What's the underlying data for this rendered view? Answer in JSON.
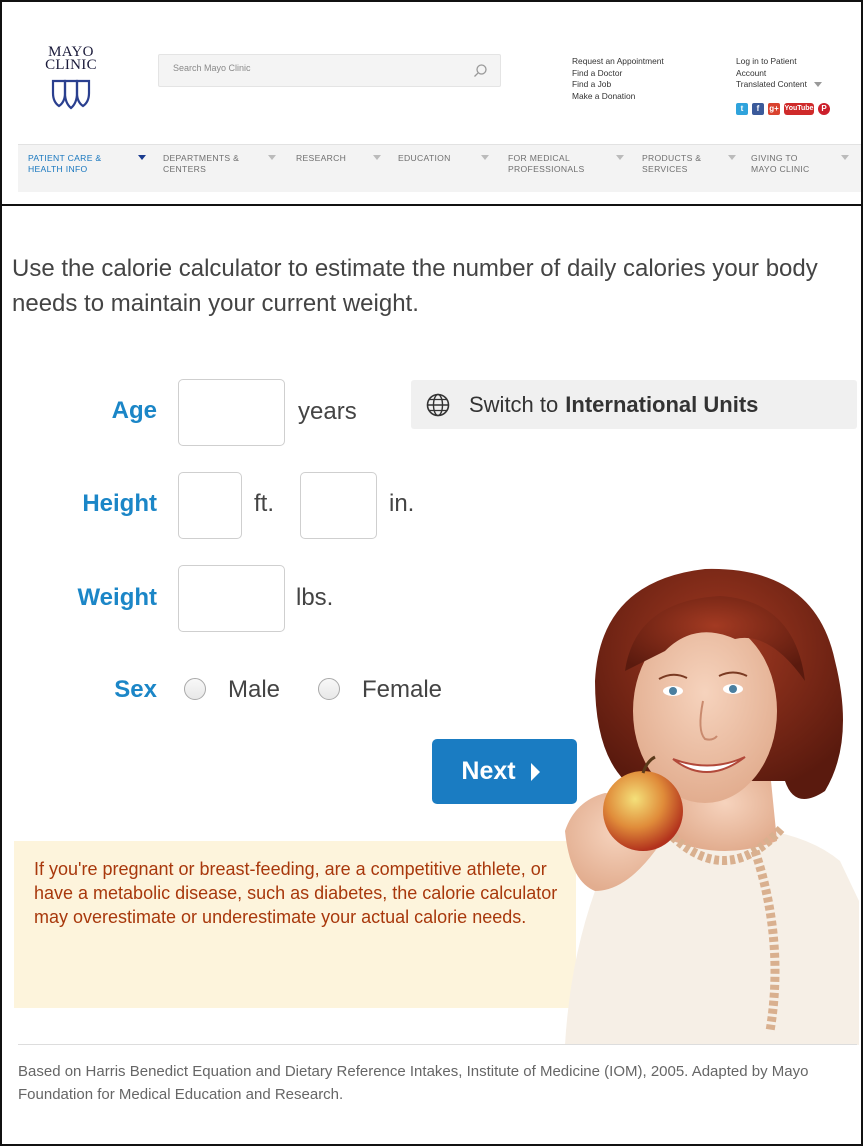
{
  "header": {
    "logo": {
      "line1": "MAYO",
      "line2": "CLINIC"
    },
    "search": {
      "placeholder": "Search Mayo Clinic",
      "icon": "search-icon"
    },
    "utility_col1": [
      "Request an Appointment",
      "Find a Doctor",
      "Find a Job",
      "Make a Donation"
    ],
    "utility_col2": {
      "login": "Log in to Patient Account",
      "translated": "Translated Content"
    },
    "social_icons": [
      "twitter-icon",
      "facebook-icon",
      "google-plus-icon",
      "youtube-icon",
      "pinterest-icon"
    ],
    "youtube_label": "YouTube",
    "nav": [
      {
        "line1": "PATIENT CARE &",
        "line2": "HEALTH INFO",
        "active": true
      },
      {
        "line1": "DEPARTMENTS &",
        "line2": "CENTERS"
      },
      {
        "line1": "RESEARCH",
        "line2": ""
      },
      {
        "line1": "EDUCATION",
        "line2": ""
      },
      {
        "line1": "FOR MEDICAL",
        "line2": "PROFESSIONALS"
      },
      {
        "line1": "PRODUCTS &",
        "line2": "SERVICES"
      },
      {
        "line1": "GIVING TO",
        "line2": "MAYO CLINIC"
      }
    ]
  },
  "calculator": {
    "intro": "Use the calorie calculator to estimate the number of daily calories your body needs to maintain your current weight.",
    "age": {
      "label": "Age",
      "unit": "years",
      "value": ""
    },
    "height": {
      "label": "Height",
      "unit_ft": "ft.",
      "unit_in": "in.",
      "ft_value": "",
      "in_value": ""
    },
    "weight": {
      "label": "Weight",
      "unit": "lbs.",
      "value": ""
    },
    "sex": {
      "label": "Sex",
      "options": [
        "Male",
        "Female"
      ],
      "selected": null
    },
    "switch_units": {
      "prefix": "Switch to",
      "bold": "International Units",
      "icon": "globe-icon"
    },
    "next_label": "Next",
    "notice": "If you're pregnant or breast-feeding, are a competitive athlete, or have a metabolic disease, such as diabetes, the calorie calculator may overestimate or underestimate your actual calorie needs.",
    "footnote": "Based on Harris Benedict Equation and Dietary Reference Intakes, Institute of Medicine (IOM), 2005. Adapted by Mayo Foundation for Medical Education and Research."
  },
  "colors": {
    "accent_blue": "#1b86c7",
    "button_blue": "#1a7cc2",
    "notice_bg": "#fdf4dc",
    "notice_text": "#a8380c",
    "nav_active": "#1877bf"
  }
}
